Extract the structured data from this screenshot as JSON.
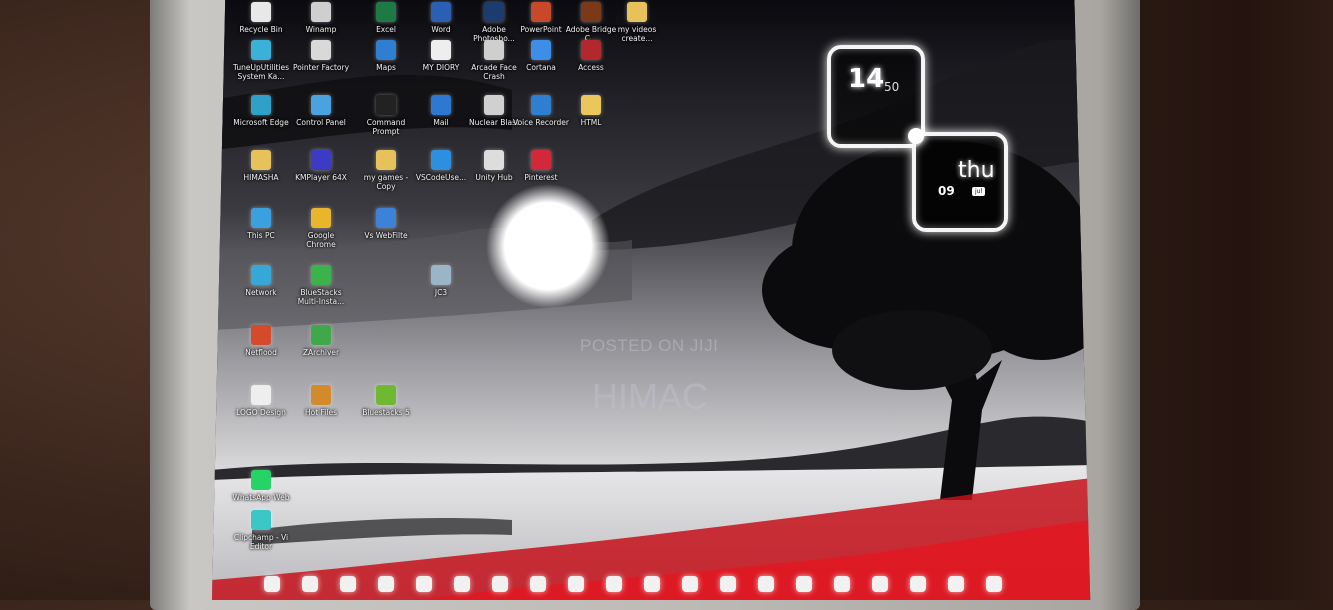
{
  "desktop": {
    "icons": [
      {
        "label": "Recycle Bin",
        "icon": "recycle-bin-icon",
        "color": "#e8e8e8"
      },
      {
        "label": "Winamp",
        "icon": "winamp-icon",
        "color": "#cfcfcf"
      },
      {
        "label": "Excel",
        "icon": "excel-icon",
        "color": "#1d7a45"
      },
      {
        "label": "Word",
        "icon": "word-icon",
        "color": "#2b5fb4"
      },
      {
        "label": "Adobe Photosho...",
        "icon": "photoshop-icon",
        "color": "#1c3b6e"
      },
      {
        "label": "PowerPoint",
        "icon": "powerpoint-icon",
        "color": "#c8482a"
      },
      {
        "label": "Adobe Bridge C...",
        "icon": "adobe-bridge-icon",
        "color": "#7a3a1a"
      },
      {
        "label": "my videos create...",
        "icon": "folder-icon",
        "color": "#e7c15a"
      },
      {
        "label": "TuneUpUtilities System Ka...",
        "icon": "tuneup-icon",
        "color": "#3ab1d8"
      },
      {
        "label": "Pointer Factory",
        "icon": "pointer-factory-icon",
        "color": "#d9d9d9"
      },
      {
        "label": "Maps",
        "icon": "maps-icon",
        "color": "#2e7fd1"
      },
      {
        "label": "MY DIORY",
        "icon": "document-icon",
        "color": "#eeeeee"
      },
      {
        "label": "Arcade Face Crash",
        "icon": "arcade-icon",
        "color": "#cfcfcf"
      },
      {
        "label": "Cortana",
        "icon": "cortana-icon",
        "color": "#3c8ee8"
      },
      {
        "label": "Access",
        "icon": "access-icon",
        "color": "#b3282d"
      },
      {
        "label": "Microsoft Edge",
        "icon": "edge-icon",
        "color": "#2fa0c8"
      },
      {
        "label": "Control Panel",
        "icon": "control-panel-icon",
        "color": "#4aa3df"
      },
      {
        "label": "Command Prompt",
        "icon": "command-prompt-icon",
        "color": "#222222"
      },
      {
        "label": "Mail",
        "icon": "mail-icon",
        "color": "#2d78d0"
      },
      {
        "label": "Nuclear Blast",
        "icon": "nuclear-icon",
        "color": "#d0d0d0"
      },
      {
        "label": "Voice Recorder",
        "icon": "voice-recorder-icon",
        "color": "#2e7fd1"
      },
      {
        "label": "HTML",
        "icon": "html-file-icon",
        "color": "#e9c75c"
      },
      {
        "label": "HIMASHA",
        "icon": "folder-icon",
        "color": "#e7c15a"
      },
      {
        "label": "KMPlayer 64X",
        "icon": "kmplayer-icon",
        "color": "#3b3bc4"
      },
      {
        "label": "my games - Copy",
        "icon": "folder-icon",
        "color": "#e7c15a"
      },
      {
        "label": "VSCodeUse...",
        "icon": "vscode-icon",
        "color": "#2d8fe0"
      },
      {
        "label": "Unity Hub",
        "icon": "unity-icon",
        "color": "#dddddd"
      },
      {
        "label": "Pinterest",
        "icon": "pinterest-icon",
        "color": "#d3273a"
      },
      {
        "label": "This PC",
        "icon": "this-pc-icon",
        "color": "#3aa0e0"
      },
      {
        "label": "Google Chrome",
        "icon": "chrome-icon",
        "color": "#e9b52a"
      },
      {
        "label": "Vs WebFilte",
        "icon": "vs-icon",
        "color": "#3b82d8"
      },
      {
        "label": "Network",
        "icon": "network-icon",
        "color": "#35a8d8"
      },
      {
        "label": "BlueStacks Multi-Insta...",
        "icon": "bluestacks-icon",
        "color": "#3bb34a"
      },
      {
        "label": "JC3",
        "icon": "jc3-icon",
        "color": "#9ab5c8"
      },
      {
        "label": "Netflood",
        "icon": "netflood-icon",
        "color": "#d44a2a"
      },
      {
        "label": "ZArchiver",
        "icon": "zarchiver-icon",
        "color": "#3fa84a"
      },
      {
        "label": "LOGO Design",
        "icon": "logo-file-icon",
        "color": "#eeeeee"
      },
      {
        "label": "Hot Files",
        "icon": "hot-files-icon",
        "color": "#d38a2a"
      },
      {
        "label": "Bluestacks 5",
        "icon": "bluestacks5-icon",
        "color": "#6fb832"
      },
      {
        "label": "WhatsApp Web",
        "icon": "whatsapp-icon",
        "color": "#25d366"
      },
      {
        "label": "Clipchamp - Vi Editor",
        "icon": "clipchamp-icon",
        "color": "#3cc7c7"
      }
    ]
  },
  "clock_widget": {
    "hour": "14",
    "minute": "50",
    "day": "thu",
    "date": "09",
    "month": "jul"
  },
  "watermark": {
    "line1": "POSTED ON JIJI",
    "line2": "HIMAC"
  },
  "taskbar": {
    "icons": [
      "home-icon",
      "clock-icon",
      "file-icon",
      "store-icon",
      "compass-icon",
      "dropbox-icon",
      "pdf-icon",
      "arrow-icon",
      "location-icon",
      "vlc-icon",
      "tools-icon",
      "twitch-icon",
      "chat-icon",
      "video-icon",
      "chrome-icon",
      "weibo-icon",
      "gmail-icon",
      "font-icon",
      "settings-icon",
      "battery-icon"
    ]
  }
}
